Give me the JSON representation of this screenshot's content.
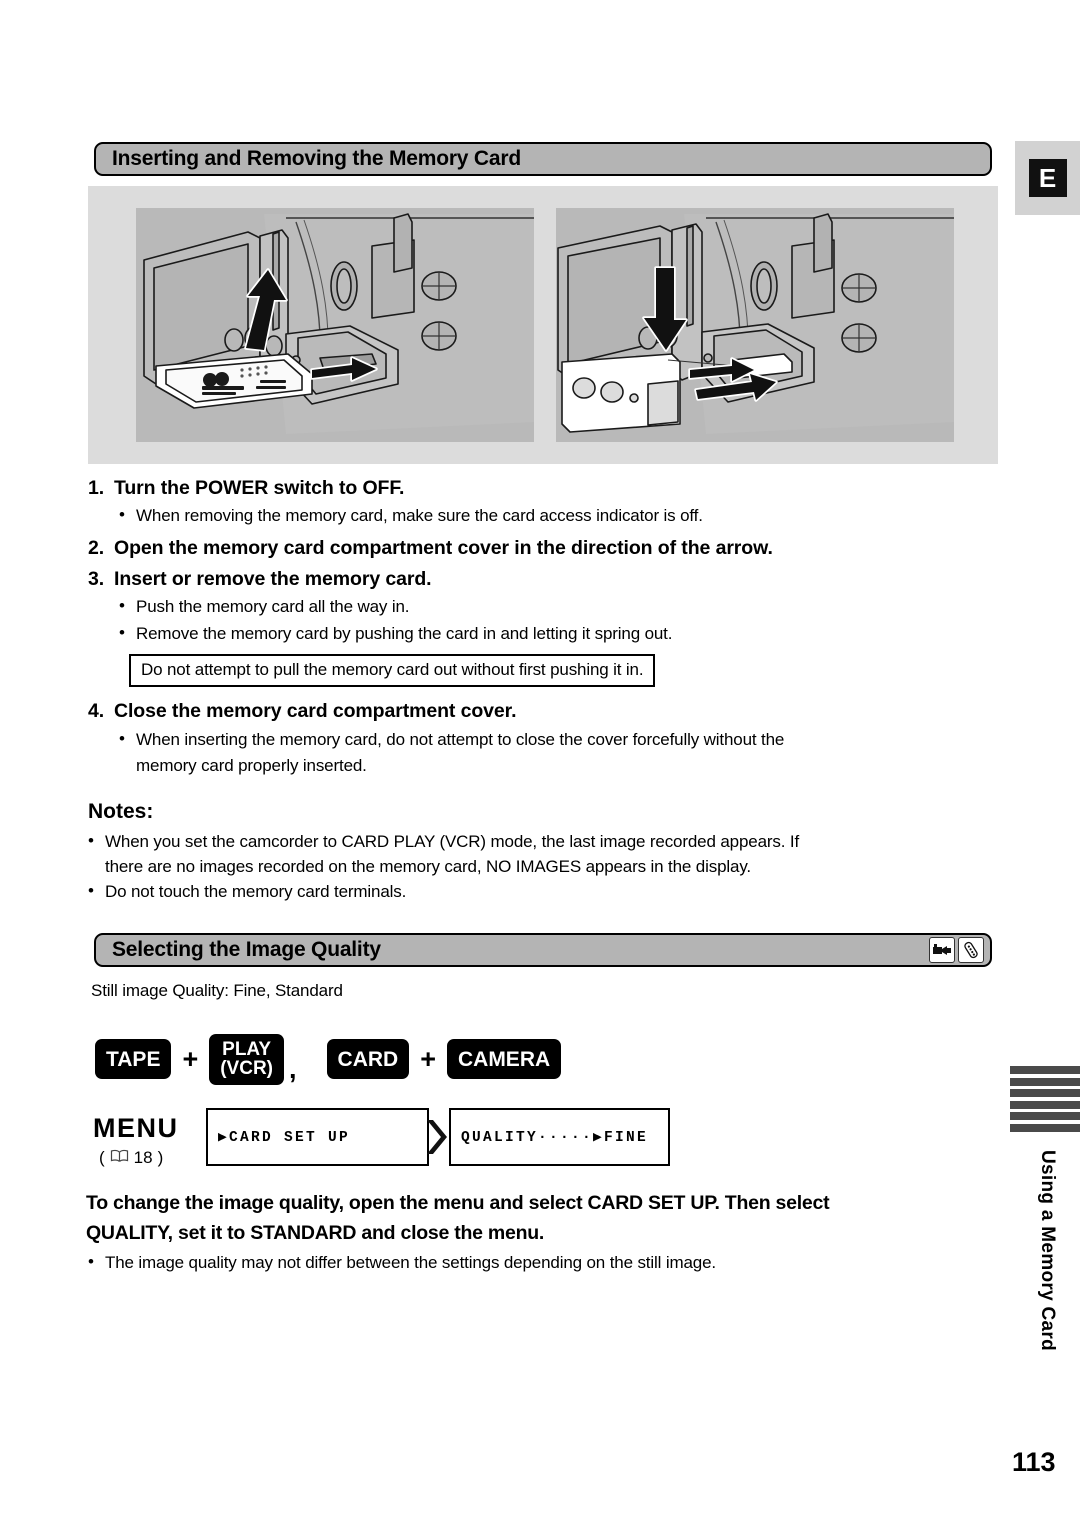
{
  "page": {
    "language_badge": "E",
    "number": "113",
    "side_tab_text": "Using a Memory Card"
  },
  "section1": {
    "title": "Inserting and Removing the Memory Card",
    "illustrations": [
      {
        "name": "camcorder-card-slot-insert",
        "caption_none": ""
      },
      {
        "name": "camcorder-card-slot-remove",
        "caption_none": ""
      }
    ],
    "steps": [
      {
        "num": "1.",
        "text": "Turn the POWER switch to OFF.",
        "bullets": [
          "When removing the memory card, make sure the card access indicator is off."
        ]
      },
      {
        "num": "2.",
        "text": "Open the memory card compartment cover in the direction of the arrow.",
        "bullets": []
      },
      {
        "num": "3.",
        "text": "Insert or remove the memory card.",
        "bullets": [
          "Push the memory card all the way in.",
          "Remove the memory card by pushing the card in and letting it spring out."
        ]
      },
      {
        "num": "4.",
        "text": "Close the memory card compartment cover.",
        "bullets": [
          "When inserting the memory card, do not attempt to close the cover forcefully without the",
          "memory card properly inserted."
        ]
      }
    ],
    "warning_box": "Do not attempt to pull the memory card out without first pushing it in.",
    "notes_title": "Notes:",
    "notes": [
      "When you set the camcorder to CARD PLAY (VCR) mode, the last image recorded appears. If",
      "there are no images recorded on the memory card, NO IMAGES appears in the display.",
      "Do not touch the memory card terminals."
    ]
  },
  "section2": {
    "title": "Selecting the Image Quality",
    "header_icons": [
      "camcorder-icon",
      "remote-control-icon"
    ],
    "subtitle": "Still image Quality: Fine, Standard",
    "mode_badges": {
      "group1": [
        "TAPE",
        "PLAY",
        "(VCR)"
      ],
      "separator_plus": "+",
      "separator_comma": ",",
      "group2": [
        "CARD",
        "CAMERA"
      ]
    },
    "menu": {
      "label": "MENU",
      "ref_open": "(",
      "ref_page": "18",
      "ref_close": ")",
      "box1": "▶CARD SET UP",
      "box2": "QUALITY·····▶FINE"
    },
    "directive_lines": [
      "To change the image quality, open the menu and select CARD SET UP. Then select",
      "QUALITY, set it to STANDARD and close the menu."
    ],
    "directive_bullet": "The image quality may not differ between the settings depending on the still image."
  }
}
